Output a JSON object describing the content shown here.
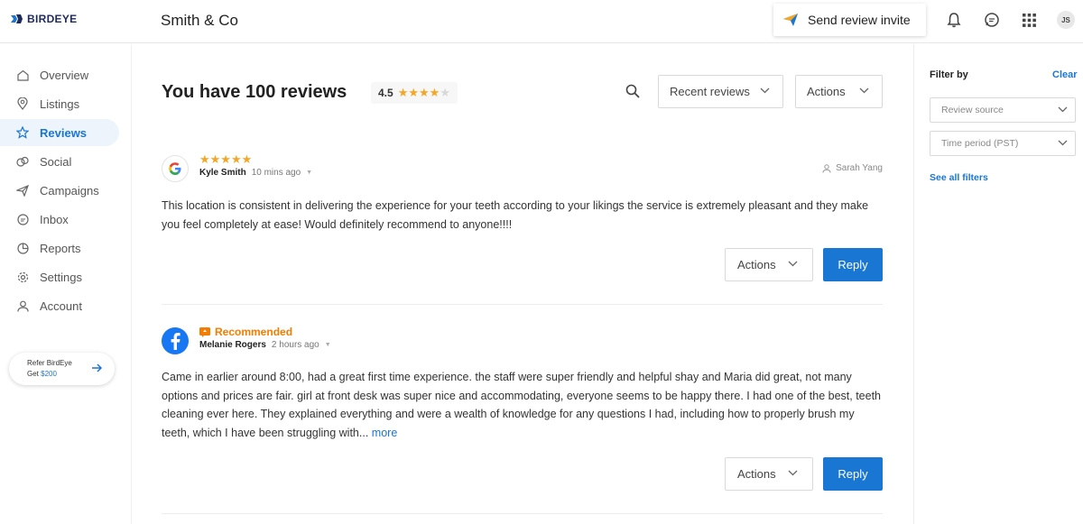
{
  "header": {
    "logo_text": "BIRDEYE",
    "business_name": "Smith & Co",
    "send_invite_label": "Send review invite",
    "avatar_initials": "JS",
    "icons": [
      "bell-icon",
      "chat-icon",
      "apps-grid-icon"
    ]
  },
  "sidebar": {
    "items": [
      {
        "label": "Overview",
        "icon": "home-icon"
      },
      {
        "label": "Listings",
        "icon": "location-pin-icon"
      },
      {
        "label": "Reviews",
        "icon": "star-icon"
      },
      {
        "label": "Social",
        "icon": "social-icon"
      },
      {
        "label": "Campaigns",
        "icon": "send-icon"
      },
      {
        "label": "Inbox",
        "icon": "inbox-icon"
      },
      {
        "label": "Reports",
        "icon": "pie-chart-icon"
      },
      {
        "label": "Settings",
        "icon": "gear-icon"
      },
      {
        "label": "Account",
        "icon": "user-icon"
      }
    ],
    "active": "Reviews",
    "refer": {
      "line1": "Refer BirdEye",
      "line2_prefix": "Get ",
      "line2_amount": "$200"
    }
  },
  "main": {
    "title": "You have 100 reviews",
    "rating": "4.5",
    "sort_dropdown": "Recent reviews",
    "actions_dropdown": "Actions",
    "reviews": [
      {
        "source": "Google",
        "stars": 5,
        "author": "Kyle Smith",
        "time": "10 mins ago",
        "assignee": "Sarah Yang",
        "text": "This location is consistent in delivering the experience for your teeth according to your likings the service is extremely pleasant and they make you feel completely at ease! Would definitely recommend to anyone!!!!",
        "actions_label": "Actions",
        "reply_label": "Reply"
      },
      {
        "source": "Facebook",
        "badge": "Recommended",
        "author": "Melanie Rogers",
        "time": "2 hours ago",
        "text": "Came in earlier around 8:00, had a great first time experience. the staff were super friendly and helpful shay and Maria did great, not many options and prices are fair. girl at front desk was super nice and accommodating, everyone seems to be happy there. I had one of the best, teeth cleaning ever here. They explained everything and were a wealth of knowledge for any questions I had, including how to properly brush my teeth, which I have been struggling with...",
        "more_label": "more",
        "actions_label": "Actions",
        "reply_label": "Reply"
      }
    ]
  },
  "filters": {
    "title": "Filter by",
    "clear_label": "Clear",
    "review_source": "Review source",
    "time_period": "Time period (PST)",
    "see_all": "See all filters"
  },
  "colors": {
    "accent": "#1976d2",
    "star": "#f5a623",
    "recommended": "#f57c00",
    "facebook": "#1877f2"
  }
}
